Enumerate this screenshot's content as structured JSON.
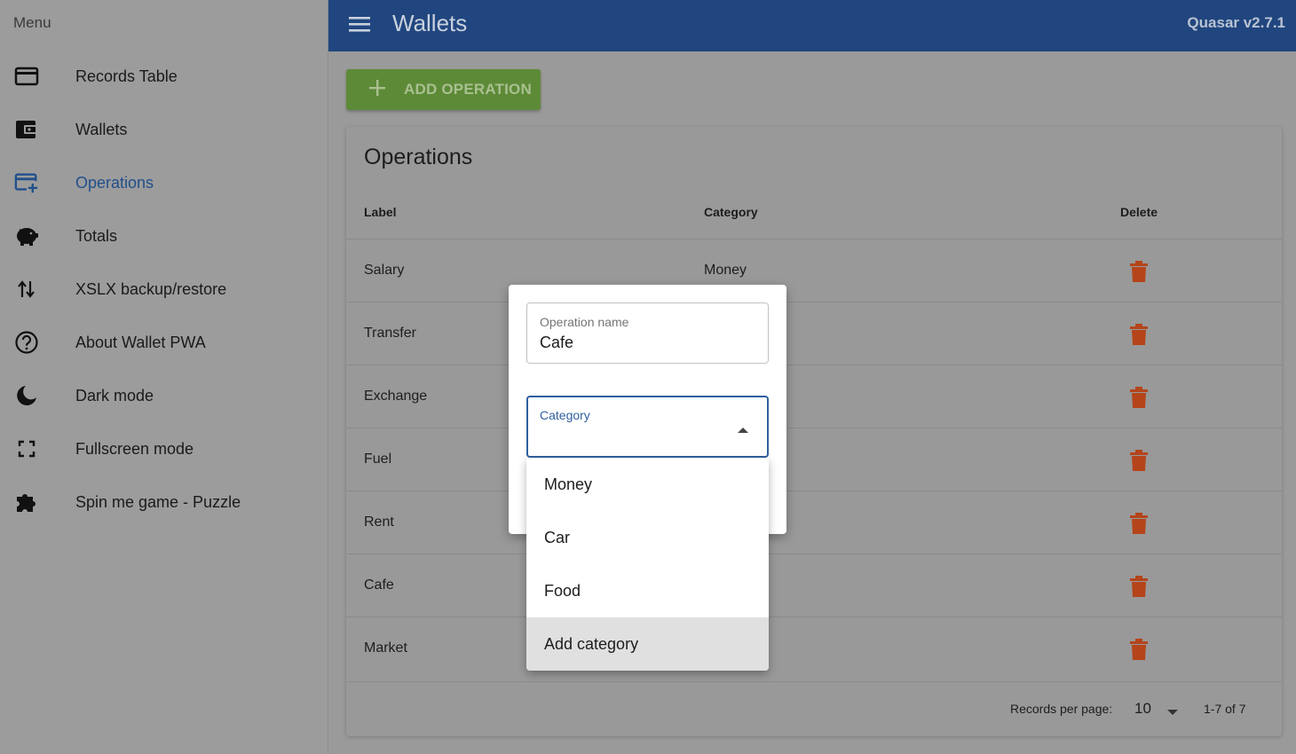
{
  "sidebar": {
    "title": "Menu",
    "items": [
      {
        "label": "Records Table",
        "icon": "credit-card-icon"
      },
      {
        "label": "Wallets",
        "icon": "wallet-icon"
      },
      {
        "label": "Operations",
        "icon": "card-plus-icon",
        "active": true
      },
      {
        "label": "Totals",
        "icon": "piggy-bank-icon"
      },
      {
        "label": "XSLX backup/restore",
        "icon": "swap-vertical-icon"
      },
      {
        "label": "About Wallet PWA",
        "icon": "help-circle-icon"
      },
      {
        "label": "Dark mode",
        "icon": "moon-icon"
      },
      {
        "label": "Fullscreen mode",
        "icon": "fullscreen-icon"
      },
      {
        "label": "Spin me game - Puzzle",
        "icon": "puzzle-icon"
      }
    ]
  },
  "header": {
    "title": "Wallets",
    "version": "Quasar v2.7.1"
  },
  "toolbar": {
    "add_label": "ADD OPERATION"
  },
  "table": {
    "title": "Operations",
    "columns": [
      "Label",
      "Category",
      "Delete"
    ],
    "rows": [
      {
        "label": "Salary",
        "category": "Money"
      },
      {
        "label": "Transfer",
        "category": ""
      },
      {
        "label": "Exchange",
        "category": ""
      },
      {
        "label": "Fuel",
        "category": ""
      },
      {
        "label": "Rent",
        "category": ""
      },
      {
        "label": "Cafe",
        "category": ""
      },
      {
        "label": "Market",
        "category": ""
      }
    ],
    "pagination": {
      "label": "Records per page:",
      "value": "10",
      "range": "1-7 of 7"
    }
  },
  "dialog": {
    "name_label": "Operation name",
    "name_value": "Cafe",
    "category_label": "Category"
  },
  "dropdown": {
    "options": [
      "Money",
      "Car",
      "Food",
      "Add category"
    ],
    "highlighted": "Add category"
  },
  "colors": {
    "header": "#21467f",
    "accent": "#2f5f9f",
    "add_button": "#5d8a37",
    "delete": "#b5441a"
  }
}
